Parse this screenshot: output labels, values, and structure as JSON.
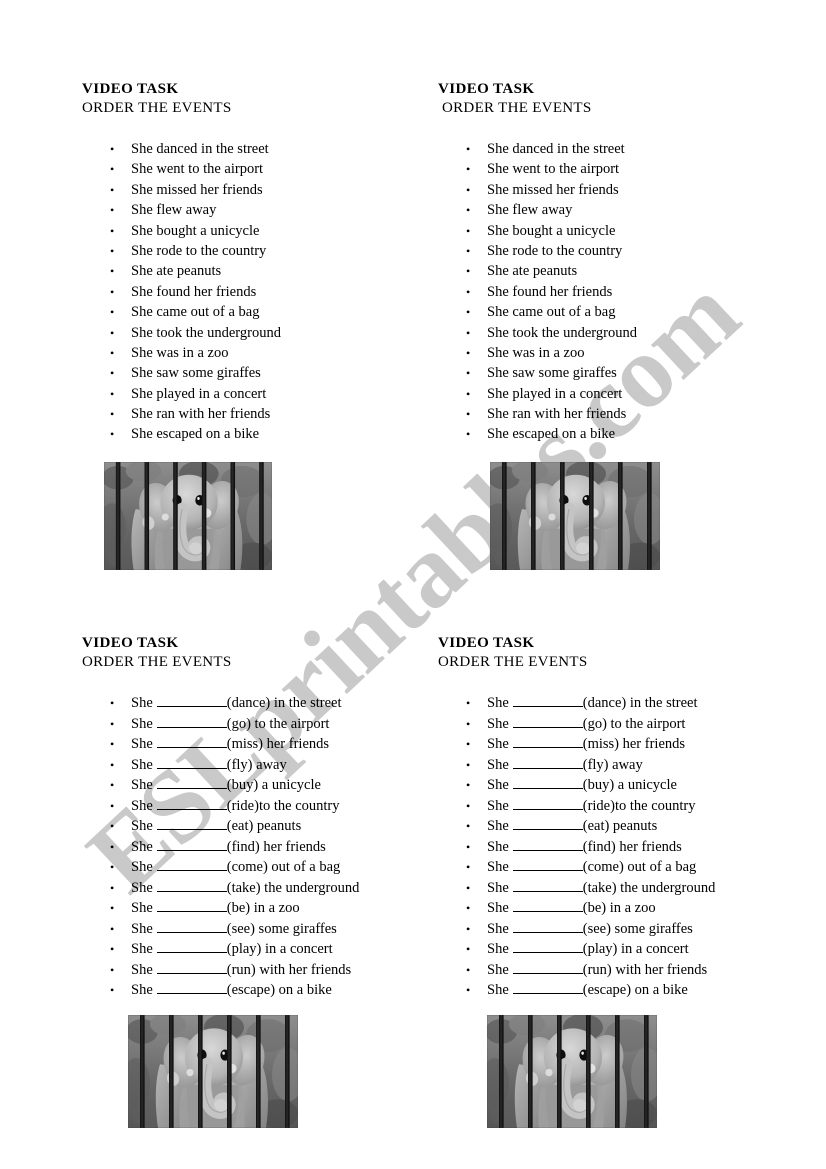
{
  "document": {
    "title": "VIDEO TASK",
    "subtitle": "ORDER THE EVENTS",
    "watermark": "ESLprintables.com",
    "watermark_color": "#c9c9c9",
    "page_background": "#ffffff",
    "text_color": "#000000"
  },
  "sections": {
    "top_left": {
      "title": "VIDEO TASK",
      "subtitle": "ORDER THE EVENTS"
    },
    "top_right": {
      "title": "VIDEO TASK",
      "subtitle": "ORDER THE EVENTS"
    },
    "bottom_left": {
      "title": "VIDEO TASK",
      "subtitle": "ORDER THE EVENTS"
    },
    "bottom_right": {
      "title": "VIDEO TASK",
      "subtitle": "ORDER THE EVENTS"
    }
  },
  "events_past": [
    "She danced in the street",
    "She went to the airport",
    "She missed her friends",
    "She flew away",
    "She bought a unicycle",
    "She rode to the country",
    "She ate peanuts",
    "She found her friends",
    "She came out of a bag",
    "She took the underground",
    "She was in a zoo",
    "She saw some giraffes",
    "She played in a concert",
    "She ran with her friends",
    "She escaped on a bike"
  ],
  "events_gapfill": [
    {
      "subject": "She",
      "blank_width": 70,
      "verb": "(dance)",
      "rest": " in the street"
    },
    {
      "subject": "She",
      "blank_width": 70,
      "verb": "(go)",
      "rest": " to the airport"
    },
    {
      "subject": "She",
      "blank_width": 70,
      "verb": "(miss)",
      "rest": " her friends"
    },
    {
      "subject": "She",
      "blank_width": 70,
      "verb": "(fly)",
      "rest": " away"
    },
    {
      "subject": "She",
      "blank_width": 70,
      "verb": "(buy)",
      "rest": " a unicycle"
    },
    {
      "subject": "She",
      "blank_width": 70,
      "verb": "(ride)",
      "rest": "to the country"
    },
    {
      "subject": "She",
      "blank_width": 70,
      "verb": "(eat)",
      "rest": " peanuts"
    },
    {
      "subject": "She",
      "blank_width": 70,
      "verb": "(find)",
      "rest": " her friends"
    },
    {
      "subject": "She",
      "blank_width": 70,
      "verb": "(come)",
      "rest": " out of a bag"
    },
    {
      "subject": "She",
      "blank_width": 70,
      "verb": "(take)",
      "rest": " the underground"
    },
    {
      "subject": "She",
      "blank_width": 70,
      "verb": "(be)",
      "rest": " in a zoo"
    },
    {
      "subject": "She",
      "blank_width": 70,
      "verb": "(see)",
      "rest": " some giraffes"
    },
    {
      "subject": "She",
      "blank_width": 70,
      "verb": "(play)",
      "rest": " in a concert"
    },
    {
      "subject": "She",
      "blank_width": 70,
      "verb": "(run)",
      "rest": " with her friends"
    },
    {
      "subject": "She",
      "blank_width": 70,
      "verb": "(escape)",
      "rest": " on a bike"
    }
  ],
  "photo": {
    "description": "person in a grey elephant costume standing behind vertical cage bars",
    "style": "black-and-white photograph",
    "count": 4
  }
}
